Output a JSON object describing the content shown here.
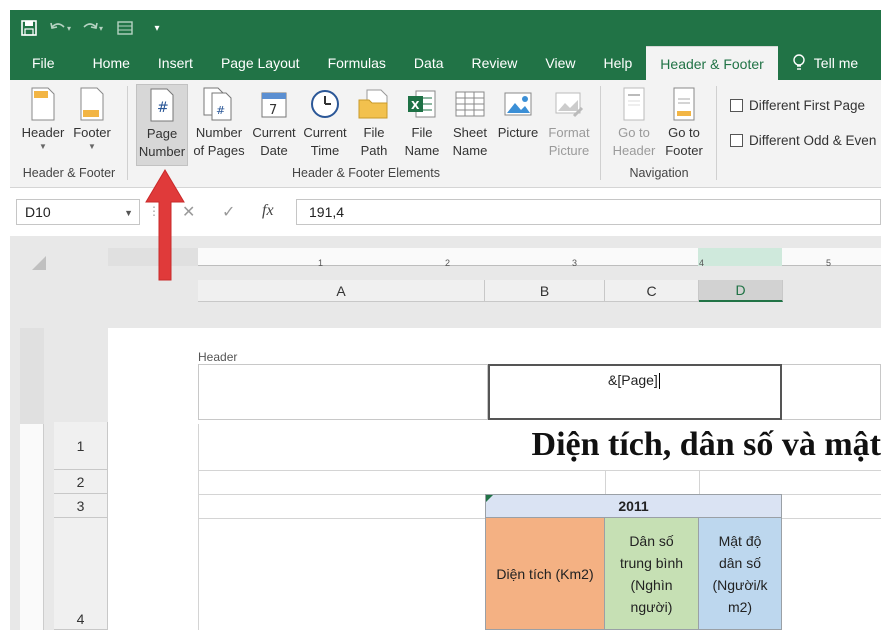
{
  "qat": {
    "save_icon": "save-icon",
    "undo_icon": "undo-icon",
    "redo_icon": "redo-icon",
    "form_icon": "form-icon",
    "customize_icon": "customize-qat-icon"
  },
  "tabs": [
    {
      "label": "File"
    },
    {
      "label": "Home"
    },
    {
      "label": "Insert"
    },
    {
      "label": "Page Layout"
    },
    {
      "label": "Formulas"
    },
    {
      "label": "Data"
    },
    {
      "label": "Review"
    },
    {
      "label": "View"
    },
    {
      "label": "Help"
    },
    {
      "label": "Header & Footer"
    }
  ],
  "tell_me": "Tell me",
  "ribbon": {
    "header": "Header",
    "footer": "Footer",
    "page_number_l1": "Page",
    "page_number_l2": "Number",
    "number_of_pages_l1": "Number",
    "number_of_pages_l2": "of Pages",
    "current_date_l1": "Current",
    "current_date_l2": "Date",
    "current_time_l1": "Current",
    "current_time_l2": "Time",
    "file_path_l1": "File",
    "file_path_l2": "Path",
    "file_name_l1": "File",
    "file_name_l2": "Name",
    "sheet_name_l1": "Sheet",
    "sheet_name_l2": "Name",
    "picture": "Picture",
    "format_picture_l1": "Format",
    "format_picture_l2": "Picture",
    "goto_header_l1": "Go to",
    "goto_header_l2": "Header",
    "goto_footer_l1": "Go to",
    "goto_footer_l2": "Footer",
    "group_hf": "Header & Footer",
    "group_elements": "Header & Footer Elements",
    "group_nav": "Navigation",
    "diff_first": "Different First Page",
    "diff_odd_even": "Different Odd & Even"
  },
  "formula": {
    "name_box": "D10",
    "value": "191,4",
    "fx": "fx"
  },
  "ruler_numbers": [
    "1",
    "2",
    "3",
    "4",
    "5"
  ],
  "columns": [
    "A",
    "B",
    "C",
    "D"
  ],
  "rows": [
    "1",
    "2",
    "3",
    "4"
  ],
  "sheet": {
    "header_label": "Header",
    "header_text": "&[Page]",
    "title": "Diện tích, dân số và mật",
    "year": "2011",
    "col_b": "Diện tích (Km2)",
    "col_c_l1": "Dân số",
    "col_c_l2": "trung bình",
    "col_c_l3": "(Nghìn",
    "col_c_l4": "người)",
    "col_d_l1": "Mật độ",
    "col_d_l2": "dân số",
    "col_d_l3": "(Người/k",
    "col_d_l4": "m2)"
  },
  "colors": {
    "excel_green": "#217346",
    "orange_fill": "#f4b183",
    "green_fill": "#c6e0b4",
    "blue_fill": "#bdd7ee",
    "year_fill": "#dae3f3",
    "arrow_red": "#e03a3a"
  }
}
